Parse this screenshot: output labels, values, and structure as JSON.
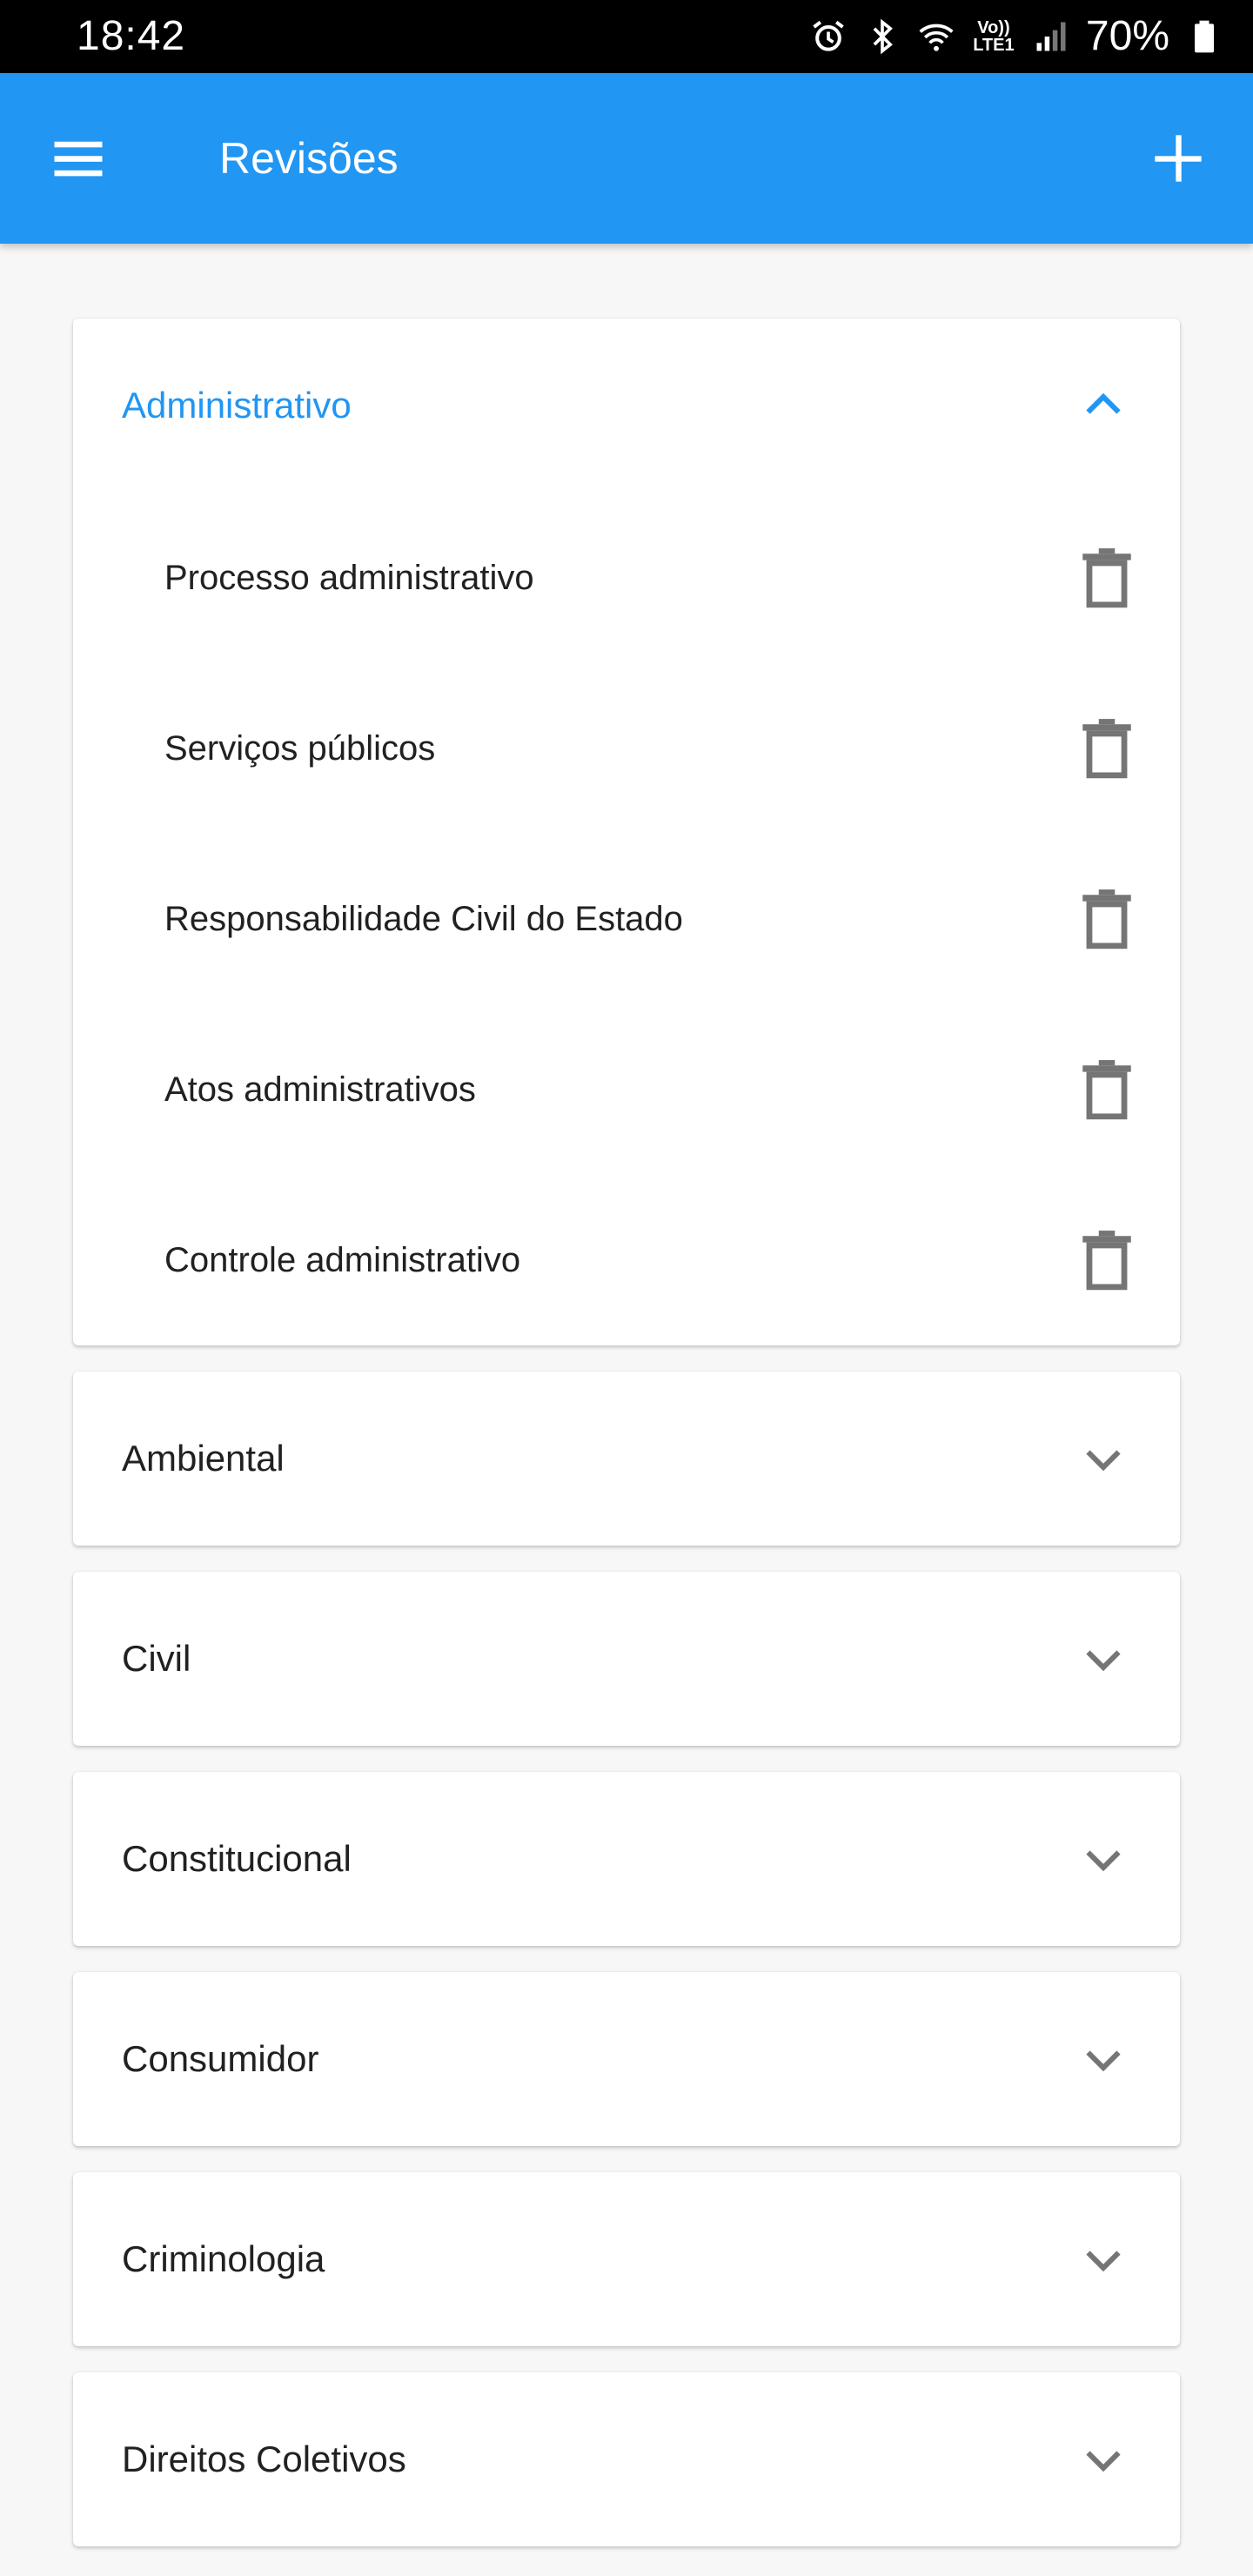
{
  "status_bar": {
    "time": "18:42",
    "network_label_top": "Vo))",
    "network_label_bottom": "LTE1",
    "battery_percent": "70%"
  },
  "app_bar": {
    "title": "Revisões",
    "menu_icon": "hamburger-menu-icon",
    "add_icon": "plus-icon"
  },
  "colors": {
    "primary": "#2196f3",
    "status_bar": "#000000",
    "background": "#f7f7f7",
    "text": "#212121",
    "icon": "#757575"
  },
  "panels": [
    {
      "title": "Administrativo",
      "expanded": true,
      "items": [
        "Processo administrativo",
        "Serviços públicos",
        "Responsabilidade Civil do Estado",
        "Atos administrativos",
        "Controle administrativo"
      ]
    },
    {
      "title": "Ambiental",
      "expanded": false
    },
    {
      "title": "Civil",
      "expanded": false
    },
    {
      "title": "Constitucional",
      "expanded": false
    },
    {
      "title": "Consumidor",
      "expanded": false
    },
    {
      "title": "Criminologia",
      "expanded": false
    },
    {
      "title": "Direitos Coletivos",
      "expanded": false
    }
  ]
}
